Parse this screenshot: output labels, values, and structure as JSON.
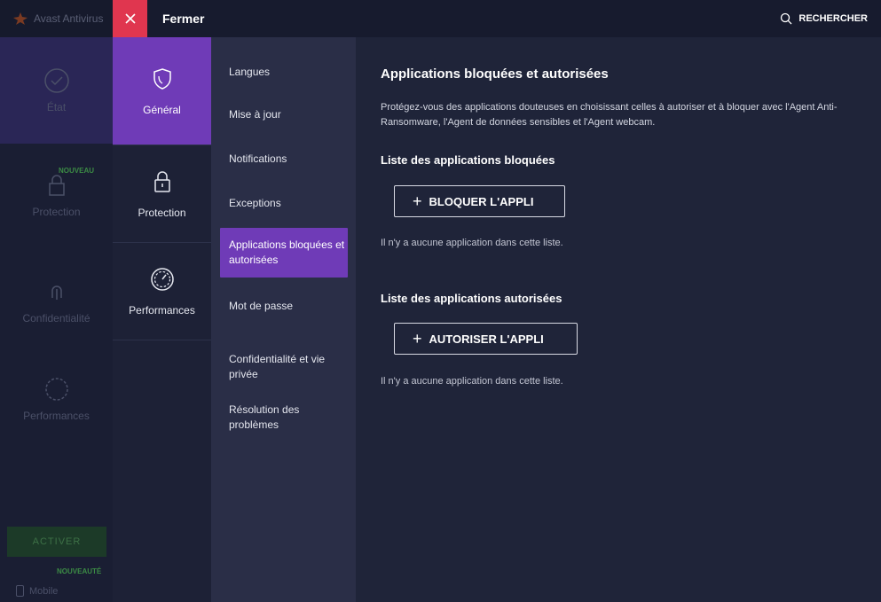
{
  "background": {
    "app_title": "Avast Antivirus",
    "nav": [
      {
        "label": "État",
        "icon": "check-circle-icon"
      },
      {
        "label": "Protection",
        "icon": "lock-icon",
        "badge": "NOUVEAU"
      },
      {
        "label": "Confidentialité",
        "icon": "fingerprint-icon"
      },
      {
        "label": "Performances",
        "icon": "gauge-icon"
      }
    ],
    "activate_label": "ACTIVER",
    "mobile_badge": "NOUVEAUTÉ",
    "mobile_label": "Mobile"
  },
  "topbar": {
    "close_label": "Fermer",
    "search_label": "RECHERCHER"
  },
  "categories": [
    {
      "label": "Général",
      "icon": "shield-icon",
      "active": true
    },
    {
      "label": "Protection",
      "icon": "lock-icon",
      "active": false
    },
    {
      "label": "Performances",
      "icon": "gauge-icon",
      "active": false
    }
  ],
  "subnav": [
    {
      "label": "Langues"
    },
    {
      "label": "Mise à jour"
    },
    {
      "label": "Notifications"
    },
    {
      "label": "Exceptions"
    },
    {
      "label": "Applications bloquées et autorisées",
      "active": true
    },
    {
      "label": "Mot de passe"
    },
    {
      "label": "Confidentialité et vie privée"
    },
    {
      "label": "Résolution des problèmes"
    }
  ],
  "content": {
    "title": "Applications bloquées et autorisées",
    "description": "Protégez-vous des applications douteuses en choisissant celles à autoriser et à bloquer avec l'Agent Anti-Ransomware, l'Agent de données sensibles et l'Agent webcam.",
    "blocked": {
      "title": "Liste des applications bloquées",
      "button": "BLOQUER L'APPLI",
      "empty": "Il n'y a aucune application dans cette liste."
    },
    "allowed": {
      "title": "Liste des applications autorisées",
      "button": "AUTORISER L'APPLI",
      "empty": "Il n'y a aucune application dans cette liste."
    }
  },
  "colors": {
    "accent_purple": "#6f3bb7",
    "close_red": "#e0364f",
    "panel_bg": "#1f2439"
  }
}
